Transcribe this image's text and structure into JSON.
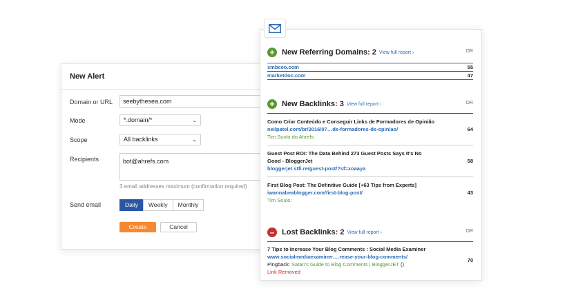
{
  "alert": {
    "title": "New Alert",
    "domain_label": "Domain or URL",
    "domain_value": "seebythesea.com",
    "mode_label": "Mode",
    "mode_value": "*.domain/*",
    "scope_label": "Scope",
    "scope_value": "All backlinks",
    "recipients_label": "Recipients",
    "recipients_value": "bot@ahrefs.com",
    "recipients_hint": "3 email addresses maximum (confirmation required)",
    "send_label": "Send email",
    "frequency_options": [
      "Daily",
      "Weekly",
      "Monthly"
    ],
    "frequency_selected": "Daily",
    "create_label": "Create",
    "cancel_label": "Cancel"
  },
  "email": {
    "icon": "envelope-icon",
    "dr_label": "DR",
    "referring": {
      "title": "New Referring Domains: 2",
      "link": "View full report ›",
      "icon": "plus-circle-icon",
      "rows": [
        {
          "domain": "smbceo.com",
          "dr": "55"
        },
        {
          "domain": "marketdoc.com",
          "dr": "47"
        }
      ]
    },
    "backlinks": {
      "title": "New Backlinks: 3",
      "link": "View full report ›",
      "icon": "plus-circle-icon",
      "items": [
        {
          "title": "Como Criar Conteúdo e Conseguir Links de Formadores de Opinião",
          "url": "neilpatel.com/br/2016/07…de-formadores-de-opiniao/",
          "anchor": "Tim Suolo do Ahrefs",
          "dr": "64"
        },
        {
          "title": "Guest Post ROI: The Data Behind 273 Guest Posts Says It's No",
          "title2": "Good - BloggerJet",
          "url": "bloggerjet.stfi.re/guest-post/?sf=xoaaya",
          "anchor": "",
          "dr": "58"
        },
        {
          "title": "First Blog Post: The Definitive Guide [+63 Tips from Experts]",
          "url": "iwannabeablogger.com/first-blog-post/",
          "anchor": "Tim Soulo:",
          "dr": "43"
        }
      ]
    },
    "lost": {
      "title": "Lost Backlinks: 2",
      "link": "View full report ›",
      "icon": "minus-circle-icon",
      "item": {
        "title": "7 Tips to Increase Your Blog Comments : Social Media Examiner",
        "url": "www.socialmediaexaminer.…rease-your-blog-comments/",
        "pingback_label": "Pingback:",
        "pingback_link": "Satan's Guide to Blog Comments | BloggerJET",
        "pingback_suffix": "()",
        "status": "Link Removed",
        "dr": "70"
      }
    }
  },
  "colors": {
    "accent": "#2a56a5",
    "create": "#f7882f",
    "green": "#5a9a2c",
    "red": "#c53030",
    "link": "#2a6bb8"
  }
}
